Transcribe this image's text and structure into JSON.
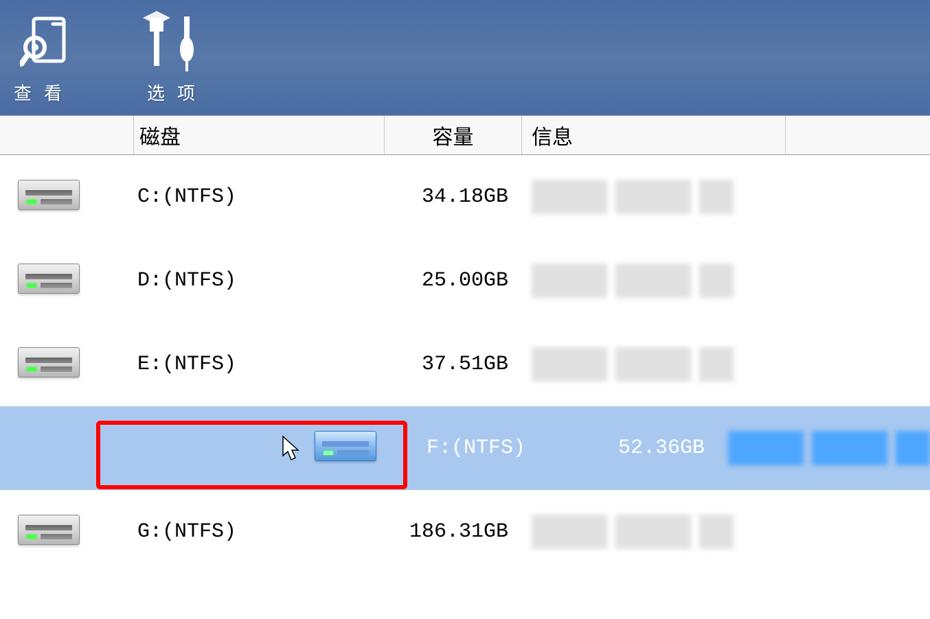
{
  "toolbar": {
    "view_label": "查看",
    "options_label": "选项"
  },
  "header": {
    "disk": "磁盘",
    "capacity": "容量",
    "info": "信息"
  },
  "disks": [
    {
      "label": "C:(NTFS)",
      "capacity": "34.18GB",
      "selected": false
    },
    {
      "label": "D:(NTFS)",
      "capacity": "25.00GB",
      "selected": false
    },
    {
      "label": "E:(NTFS)",
      "capacity": "37.51GB",
      "selected": false
    },
    {
      "label": "F:(NTFS)",
      "capacity": "52.36GB",
      "selected": true
    },
    {
      "label": "G:(NTFS)",
      "capacity": "186.31GB",
      "selected": false
    }
  ]
}
